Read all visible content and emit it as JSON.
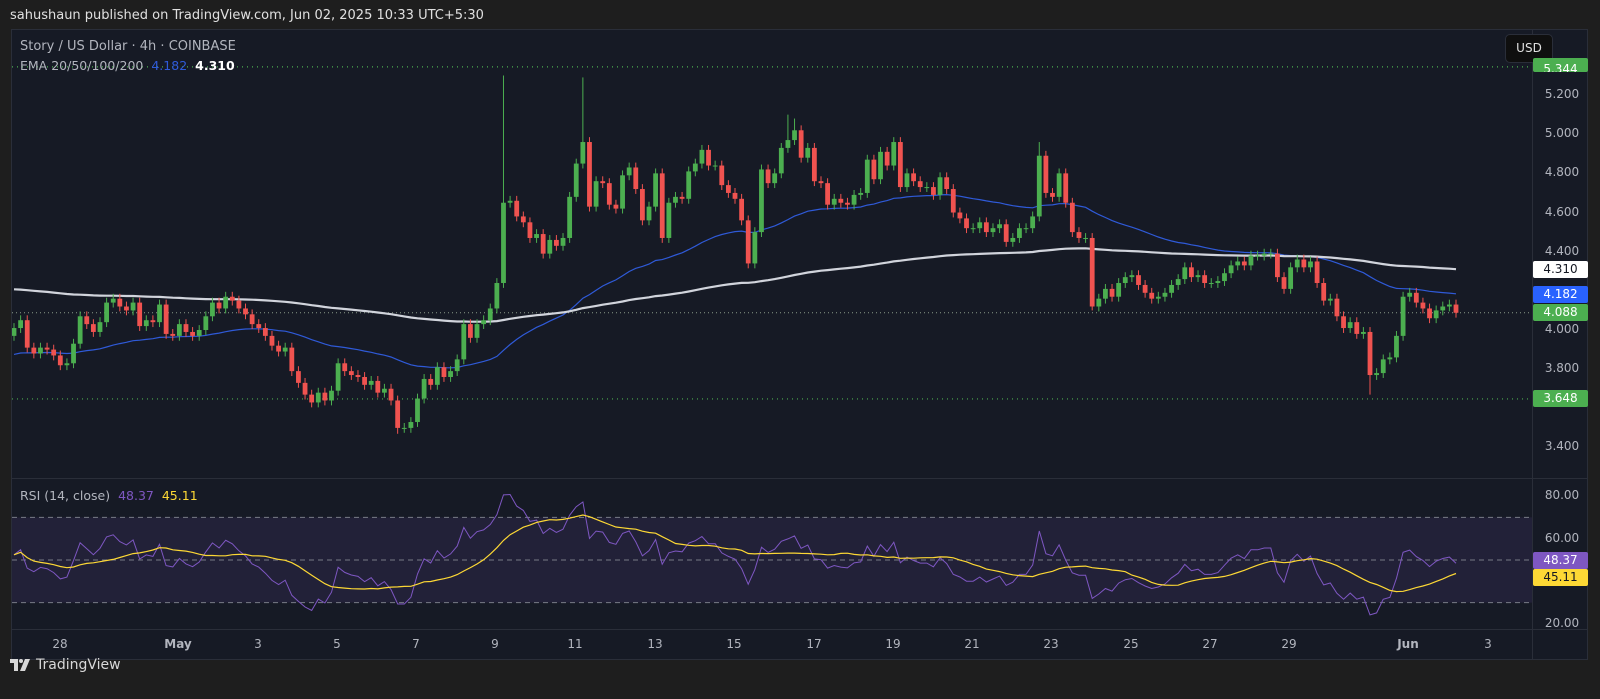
{
  "header": {
    "published": "sahushaun published on TradingView.com, Jun 02, 2025 10:33 UTC+5:30"
  },
  "legend": {
    "symbol": "Story / US Dollar · 4h · COINBASE",
    "ema_label": "EMA 20/50/100/200",
    "ema_blue_value": "4.182",
    "ema_white_value": "4.310",
    "rsi_label": "RSI (14, close)",
    "rsi_value": "48.37",
    "rsi_ma_value": "45.11"
  },
  "currency_button": "USD",
  "footer": {
    "brand": "TradingView"
  },
  "price_labels": {
    "high_level": "5.344",
    "ema_white": "4.310",
    "ema_blue": "4.182",
    "last_price": "4.088",
    "low_level": "3.648",
    "rsi": "48.37",
    "rsi_ma": "45.11"
  },
  "colors": {
    "up": "#4caf50",
    "down": "#f05350",
    "ema_blue": "#2f5ad8",
    "ema_white": "#d1d4dc",
    "rsi": "#7e57c2",
    "rsi_ma": "#fdd835",
    "level_green": "#4caf50"
  },
  "chart_data": {
    "type": "candlestick",
    "title": "Story / US Dollar · 4h · COINBASE",
    "interval": "4h",
    "y_ticks": [
      "5.200",
      "5.000",
      "4.800",
      "4.600",
      "4.400",
      "4.000",
      "3.800",
      "3.400"
    ],
    "y_tick_values": [
      5.2,
      5.0,
      4.8,
      4.6,
      4.4,
      4.0,
      3.8,
      3.4
    ],
    "x_ticks": [
      "28",
      "May",
      "3",
      "5",
      "7",
      "9",
      "11",
      "13",
      "15",
      "17",
      "19",
      "21",
      "23",
      "25",
      "27",
      "29",
      "Jun",
      "3"
    ],
    "x_tick_candle_index": [
      3,
      21,
      33,
      45,
      57,
      69,
      81,
      93,
      105,
      117,
      129,
      141,
      153,
      165,
      177,
      189,
      207,
      219
    ],
    "horizontal_levels": [
      5.344,
      3.648
    ],
    "last_price": 4.088,
    "first_open": 3.97,
    "close": [
      4.01,
      4.05,
      3.91,
      3.88,
      3.91,
      3.9,
      3.87,
      3.82,
      3.83,
      3.93,
      4.07,
      4.03,
      3.99,
      4.04,
      4.14,
      4.16,
      4.12,
      4.1,
      4.14,
      4.02,
      4.05,
      4.04,
      4.13,
      3.98,
      3.97,
      4.03,
      3.99,
      3.97,
      4.0,
      4.07,
      4.14,
      4.11,
      4.17,
      4.15,
      4.11,
      4.08,
      4.03,
      4.01,
      3.97,
      3.92,
      3.89,
      3.91,
      3.79,
      3.73,
      3.67,
      3.63,
      3.68,
      3.64,
      3.69,
      3.83,
      3.79,
      3.77,
      3.76,
      3.72,
      3.74,
      3.68,
      3.7,
      3.64,
      3.5,
      3.5,
      3.53,
      3.65,
      3.75,
      3.72,
      3.81,
      3.76,
      3.79,
      3.85,
      4.03,
      3.96,
      4.03,
      4.05,
      4.11,
      4.24,
      4.65,
      4.66,
      4.58,
      4.55,
      4.47,
      4.49,
      4.39,
      4.46,
      4.43,
      4.47,
      4.68,
      4.85,
      4.96,
      4.63,
      4.76,
      4.75,
      4.64,
      4.62,
      4.79,
      4.83,
      4.72,
      4.56,
      4.63,
      4.8,
      4.47,
      4.65,
      4.68,
      4.67,
      4.81,
      4.85,
      4.92,
      4.84,
      4.84,
      4.74,
      4.7,
      4.67,
      4.56,
      4.34,
      4.5,
      4.82,
      4.75,
      4.8,
      4.93,
      4.97,
      5.02,
      4.88,
      4.93,
      4.76,
      4.75,
      4.64,
      4.67,
      4.65,
      4.64,
      4.69,
      4.7,
      4.87,
      4.77,
      4.91,
      4.84,
      4.96,
      4.73,
      4.8,
      4.76,
      4.73,
      4.73,
      4.69,
      4.78,
      4.72,
      4.6,
      4.57,
      4.52,
      4.52,
      4.55,
      4.5,
      4.52,
      4.54,
      4.45,
      4.47,
      4.52,
      4.52,
      4.58,
      4.89,
      4.7,
      4.68,
      4.8,
      4.65,
      4.5,
      4.47,
      4.47,
      4.12,
      4.16,
      4.21,
      4.17,
      4.24,
      4.27,
      4.28,
      4.23,
      4.19,
      4.16,
      4.17,
      4.19,
      4.23,
      4.26,
      4.32,
      4.27,
      4.28,
      4.24,
      4.24,
      4.25,
      4.29,
      4.33,
      4.35,
      4.33,
      4.38,
      4.38,
      4.39,
      4.39,
      4.27,
      4.21,
      4.32,
      4.36,
      4.32,
      4.35,
      4.24,
      4.15,
      4.16,
      4.07,
      4.01,
      4.04,
      3.98,
      3.99,
      3.77,
      3.78,
      3.85,
      3.86,
      3.97,
      4.17,
      4.19,
      4.14,
      4.11,
      4.06,
      4.1,
      4.12,
      4.13,
      4.088
    ],
    "wicks": [
      {
        "i": 74,
        "high": 5.3
      },
      {
        "i": 86,
        "high": 5.29
      },
      {
        "i": 58,
        "low": 3.47
      },
      {
        "i": 163,
        "low": 4.1
      },
      {
        "i": 205,
        "low": 3.67
      },
      {
        "i": 155,
        "high": 4.96
      },
      {
        "i": 117,
        "high": 5.1
      },
      {
        "i": 118,
        "high": 5.08
      }
    ],
    "ema": [
      {
        "name": "EMA 50",
        "period": 50,
        "seed": 3.87,
        "last": 4.182
      },
      {
        "name": "EMA 200",
        "period": 200,
        "seed": 4.21,
        "last": 4.31
      }
    ],
    "rsi": {
      "period": 14,
      "ma_period": 14,
      "last": 48.37,
      "ma_last": 45.11,
      "y_ticks": [
        "80.00",
        "60.00",
        "20.00"
      ],
      "y_tick_values": [
        80,
        60,
        20
      ],
      "bands": [
        70,
        50,
        30
      ]
    }
  }
}
